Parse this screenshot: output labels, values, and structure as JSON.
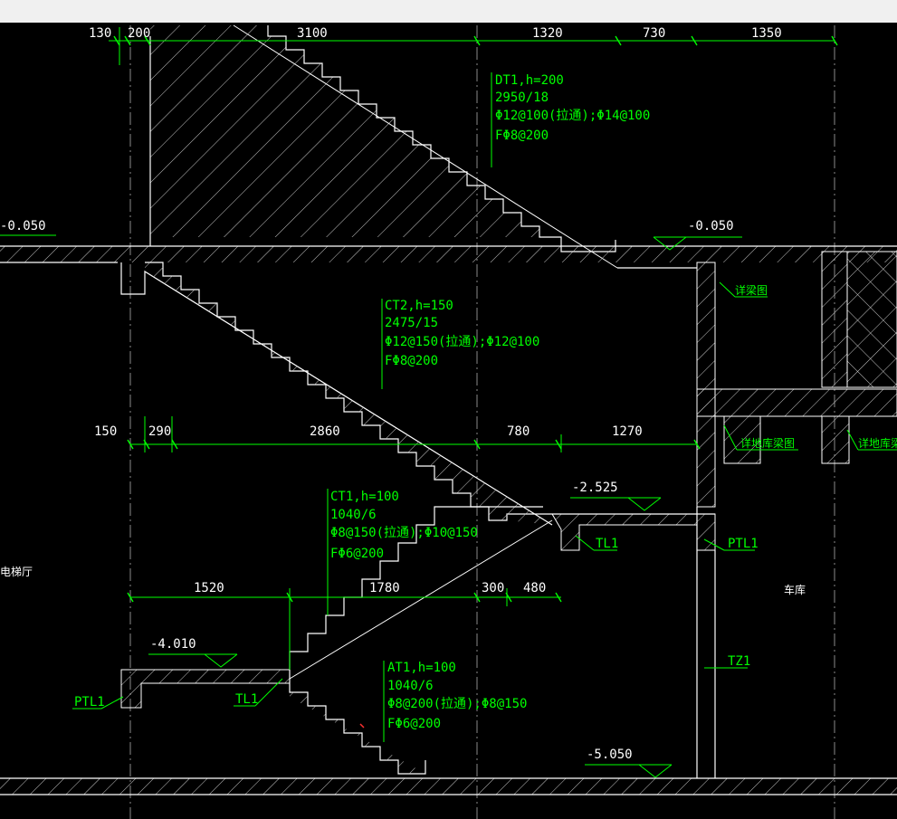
{
  "colors": {
    "background": "#000000",
    "annotation": "#00ff00",
    "geometry": "#ffffff",
    "hatch": "#c8c8c8",
    "axis": "#8a8a8a"
  },
  "dimensions": {
    "top": [
      "130",
      "200",
      "3100",
      "1320",
      "730",
      "1350"
    ],
    "mid": [
      "150",
      "290",
      "2860",
      "780",
      "1270"
    ],
    "low": [
      "1520",
      "1780",
      "300",
      "480"
    ]
  },
  "elevations": {
    "top_left": "-0.050",
    "top_right": "-0.050",
    "mid": "-2.525",
    "low_left": "-4.010",
    "bottom": "-5.050"
  },
  "stairs": {
    "dt1": [
      "DT1,h=200",
      "2950/18",
      "Φ12@100(拉通);Φ14@100",
      "FΦ8@200"
    ],
    "ct2": [
      "CT2,h=150",
      "2475/15",
      "Φ12@150(拉通);Φ12@100",
      "FΦ8@200"
    ],
    "ct1": [
      "CT1,h=100",
      "1040/6",
      "Φ8@150(拉通);Φ10@150",
      "FΦ6@200"
    ],
    "at1": [
      "AT1,h=100",
      "1040/6",
      "Φ8@200(拉通);Φ8@150",
      "FΦ6@200"
    ]
  },
  "labels": {
    "detail_beam": "详梁图",
    "detail_foundation_1": "详地库梁图",
    "detail_foundation_2": "详地库梁图",
    "tl1_mid": "TL1",
    "tl1_low": "TL1",
    "ptl1_right": "PTL1",
    "ptl1_left": "PTL1",
    "tz1": "TZ1"
  },
  "rooms": {
    "left": "电梯厅",
    "right": "车库"
  }
}
